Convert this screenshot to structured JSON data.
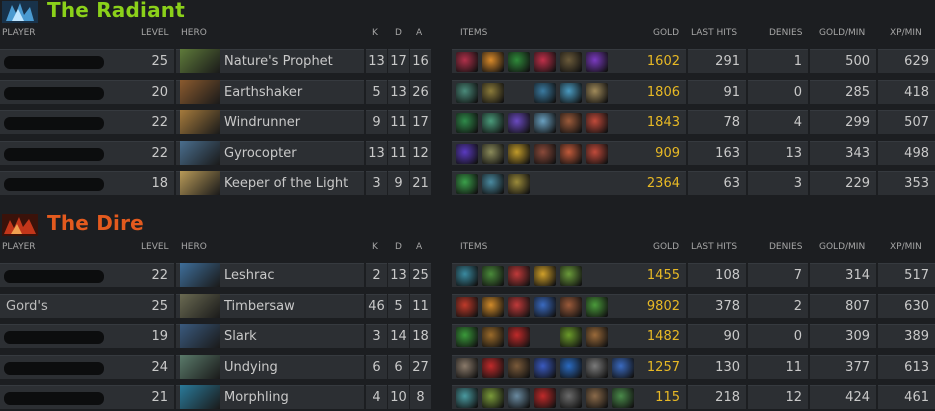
{
  "columns": {
    "player": "PLAYER",
    "level": "LEVEL",
    "hero": "HERO",
    "k": "K",
    "d": "D",
    "a": "A",
    "items": "ITEMS",
    "gold": "GOLD",
    "last_hits": "LAST HITS",
    "denies": "DENIES",
    "gold_min": "GOLD/MIN",
    "xp_min": "XP/MIN"
  },
  "radiant": {
    "title": "The Radiant",
    "color": "#8bd11a",
    "players": [
      {
        "player": "",
        "level": "25",
        "hero": "Nature's Prophet",
        "k": "13",
        "d": "17",
        "a": "16",
        "gold": "1602",
        "last_hits": "291",
        "denies": "1",
        "gold_min": "500",
        "xp_min": "629",
        "portrait": "#5e7a3a"
      },
      {
        "player": "",
        "level": "20",
        "hero": "Earthshaker",
        "k": "5",
        "d": "13",
        "a": "26",
        "gold": "1806",
        "last_hits": "91",
        "denies": "0",
        "gold_min": "285",
        "xp_min": "418",
        "portrait": "#8a5a2e"
      },
      {
        "player": "",
        "level": "22",
        "hero": "Windrunner",
        "k": "9",
        "d": "11",
        "a": "17",
        "gold": "1843",
        "last_hits": "78",
        "denies": "4",
        "gold_min": "299",
        "xp_min": "507",
        "portrait": "#a57a3c"
      },
      {
        "player": "",
        "level": "22",
        "hero": "Gyrocopter",
        "k": "13",
        "d": "11",
        "a": "12",
        "gold": "909",
        "last_hits": "163",
        "denies": "13",
        "gold_min": "343",
        "xp_min": "498",
        "portrait": "#4a6e8e"
      },
      {
        "player": "",
        "level": "18",
        "hero": "Keeper of the Light",
        "k": "3",
        "d": "9",
        "a": "21",
        "gold": "2364",
        "last_hits": "63",
        "denies": "3",
        "gold_min": "229",
        "xp_min": "353",
        "portrait": "#b89a58"
      }
    ]
  },
  "dire": {
    "title": "The Dire",
    "color": "#e35a1e",
    "players": [
      {
        "player": "",
        "level": "22",
        "hero": "Leshrac",
        "k": "2",
        "d": "13",
        "a": "25",
        "gold": "1455",
        "last_hits": "108",
        "denies": "7",
        "gold_min": "314",
        "xp_min": "517",
        "portrait": "#3e6e9a"
      },
      {
        "player": "Gord's",
        "level": "25",
        "hero": "Timbersaw",
        "k": "46",
        "d": "5",
        "a": "11",
        "gold": "9802",
        "last_hits": "378",
        "denies": "2",
        "gold_min": "807",
        "xp_min": "630",
        "portrait": "#6a6a52"
      },
      {
        "player": "",
        "level": "19",
        "hero": "Slark",
        "k": "3",
        "d": "14",
        "a": "18",
        "gold": "1482",
        "last_hits": "90",
        "denies": "0",
        "gold_min": "309",
        "xp_min": "389",
        "portrait": "#3a5a7e"
      },
      {
        "player": "",
        "level": "24",
        "hero": "Undying",
        "k": "6",
        "d": "6",
        "a": "27",
        "gold": "1257",
        "last_hits": "130",
        "denies": "11",
        "gold_min": "377",
        "xp_min": "613",
        "portrait": "#5a7a6a"
      },
      {
        "player": "",
        "level": "21",
        "hero": "Morphling",
        "k": "4",
        "d": "10",
        "a": "8",
        "gold": "115",
        "last_hits": "218",
        "denies": "12",
        "gold_min": "424",
        "xp_min": "461",
        "portrait": "#2a7a9a"
      }
    ]
  },
  "items": {
    "radiant": [
      [
        "#b0304a",
        "#d98a2a",
        "#2f8a3a",
        "#c0304a",
        "#6a5a3a",
        "#7a3ac0"
      ],
      [
        "#4a8a7a",
        "#8a7a3a",
        "",
        "#3a7aa0",
        "#4a9ac0",
        "#a08a5a"
      ],
      [
        "#2f8a4a",
        "#4a9a7a",
        "#6a4ac0",
        "#6aa0c0",
        "#9a5a3a",
        "#c04a3a"
      ],
      [
        "#5a3ac0",
        "#8a8a5a",
        "#c09a2a",
        "#8a4a3a",
        "#c05a3a",
        "#c04a3a"
      ],
      [
        "#3aa04a",
        "#4a8aa0",
        "#9a8a3a"
      ]
    ],
    "dire": [
      [
        "#3a8aa0",
        "#4a8a3a",
        "#c03a3a",
        "#d0a02a",
        "#6a9a3a"
      ],
      [
        "#c03a2a",
        "#d08a2a",
        "#c03a3a",
        "#3a6ac0",
        "#9a5a3a",
        "#4a9a3a"
      ],
      [
        "#3a9a3a",
        "#9a6a2a",
        "#c02a2a",
        "",
        "#6a9a2a",
        "#9a6a3a"
      ],
      [
        "#8a7a6a",
        "#c02a2a",
        "#7a5a3a",
        "#3a5ac0",
        "#2a6ac0",
        "#7a7a7a",
        "#3a6ac0"
      ],
      [
        "#4a9aa0",
        "#7a9a3a",
        "#6a8aa0",
        "#c02a2a",
        "#6a6a6a",
        "#8a6a4a",
        "#4a8a4a"
      ]
    ]
  }
}
